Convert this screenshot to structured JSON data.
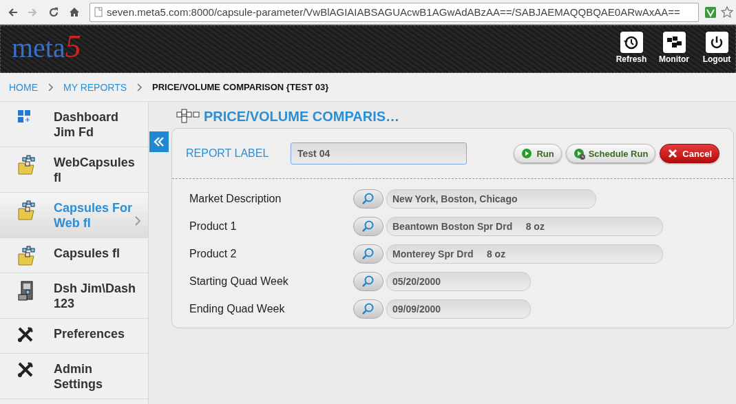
{
  "browser": {
    "url": "seven.meta5.com:8000/capsule-parameter/VwBlAGIAIABSAGUAcwB1AGwAdABzAA==/SABJAEMAQQBQAE0ARwAxAA=="
  },
  "header": {
    "logo": "meta",
    "logo_mark": "5",
    "actions": [
      {
        "label": "Refresh"
      },
      {
        "label": "Monitor"
      },
      {
        "label": "Logout"
      }
    ]
  },
  "breadcrumb": [
    {
      "label": "HOME",
      "current": false
    },
    {
      "label": "MY REPORTS",
      "current": false
    },
    {
      "label": "PRICE/VOLUME COMPARISON {TEST 03}",
      "current": true
    }
  ],
  "sidebar": {
    "items": [
      {
        "label": "Dashboard Jim Fd",
        "kind": "dashboard",
        "selected": false
      },
      {
        "label": "WebCapsules fl",
        "kind": "folder",
        "selected": false
      },
      {
        "label": "Capsules For Web fl",
        "kind": "folder",
        "selected": true
      },
      {
        "label": "Capsules fl",
        "kind": "folder",
        "selected": false
      },
      {
        "label": "Dsh Jim\\Dash 123",
        "kind": "cabinet",
        "selected": false
      },
      {
        "label": "Preferences",
        "kind": "tools",
        "selected": false
      },
      {
        "label": "Admin Settings",
        "kind": "tools",
        "selected": false
      }
    ]
  },
  "page_title": "PRICE/VOLUME COMPARIS…",
  "report_label": {
    "label": "REPORT LABEL",
    "value": "Test 04"
  },
  "buttons": [
    {
      "label": "Run",
      "kind": "run"
    },
    {
      "label": "Schedule Run",
      "kind": "schedule"
    },
    {
      "label": "Cancel",
      "kind": "cancel"
    }
  ],
  "parameters": [
    {
      "label": "Market Description",
      "value": "New York, Boston, Chicago"
    },
    {
      "label": "Product 1",
      "value": "Beantown Boston Spr Drd     8 oz"
    },
    {
      "label": "Product 2",
      "value": "Monterey Spr Drd     8 oz"
    },
    {
      "label": "Starting Quad Week",
      "value": "05/20/2000"
    },
    {
      "label": "Ending Quad Week",
      "value": "09/09/2000"
    }
  ]
}
